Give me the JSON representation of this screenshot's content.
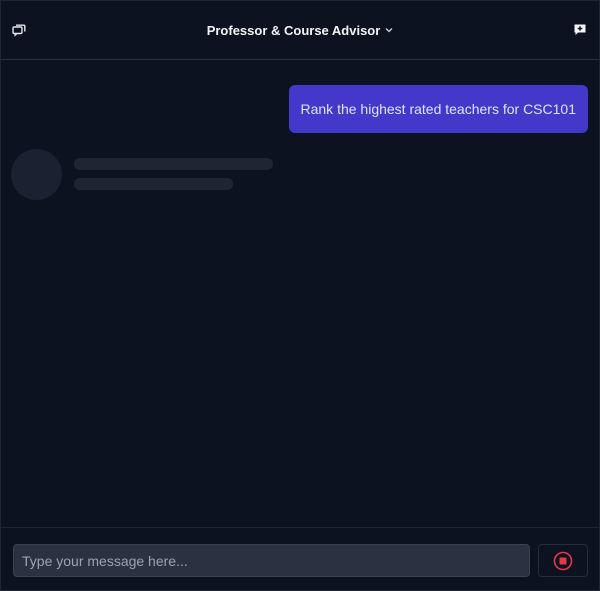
{
  "header": {
    "title": "Professor & Course Advisor",
    "left_icon": "chat-history-icon",
    "right_icon": "new-chat-icon",
    "dropdown_icon": "chevron-down-icon"
  },
  "conversation": {
    "messages": [
      {
        "role": "user",
        "text": "Rank the highest rated teachers for CSC101"
      }
    ],
    "assistant_state": "loading"
  },
  "composer": {
    "placeholder": "Type your message here...",
    "value": "",
    "stop_icon": "stop-icon"
  },
  "colors": {
    "background": "#0d1220",
    "user_bubble": "#4338ca",
    "stop_accent": "#e0394a",
    "input_bg": "#2b3140"
  }
}
